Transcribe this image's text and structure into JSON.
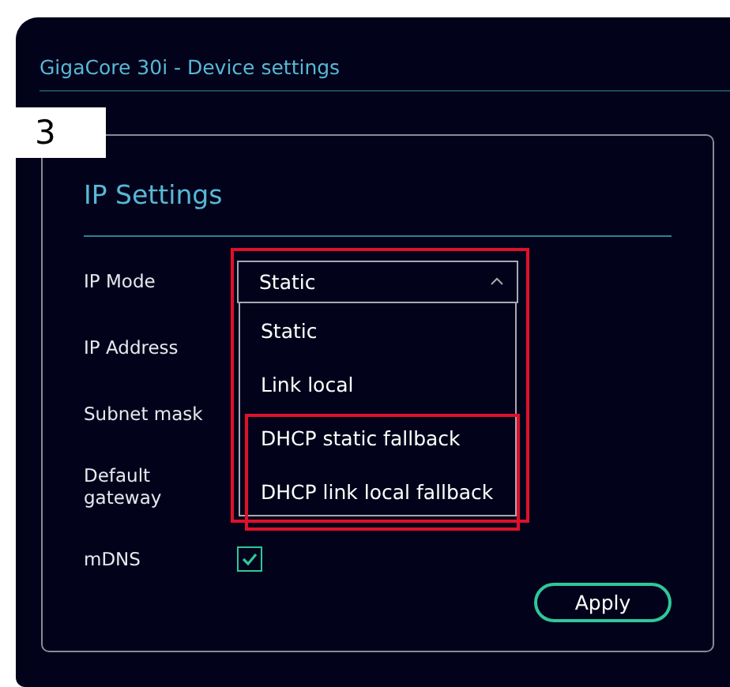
{
  "window": {
    "title": "GigaCore 30i - Device settings"
  },
  "step_label": "3",
  "panel": {
    "title": "IP Settings"
  },
  "fields": [
    {
      "label": "IP Mode",
      "kind": "select",
      "value": "Static",
      "expanded": true
    },
    {
      "label": "IP Address",
      "kind": "hidden"
    },
    {
      "label": "Subnet mask",
      "kind": "hidden"
    },
    {
      "label": "Default gateway",
      "kind": "hidden"
    },
    {
      "label": "mDNS",
      "kind": "checkbox",
      "checked": true
    }
  ],
  "dropdown_options": [
    {
      "label": "Static",
      "highlighted": false
    },
    {
      "label": "Link local",
      "highlighted": false
    },
    {
      "label": "DHCP static fallback",
      "highlighted": true
    },
    {
      "label": "DHCP link local fallback",
      "highlighted": true
    }
  ],
  "buttons": [
    {
      "label": "Apply"
    }
  ]
}
